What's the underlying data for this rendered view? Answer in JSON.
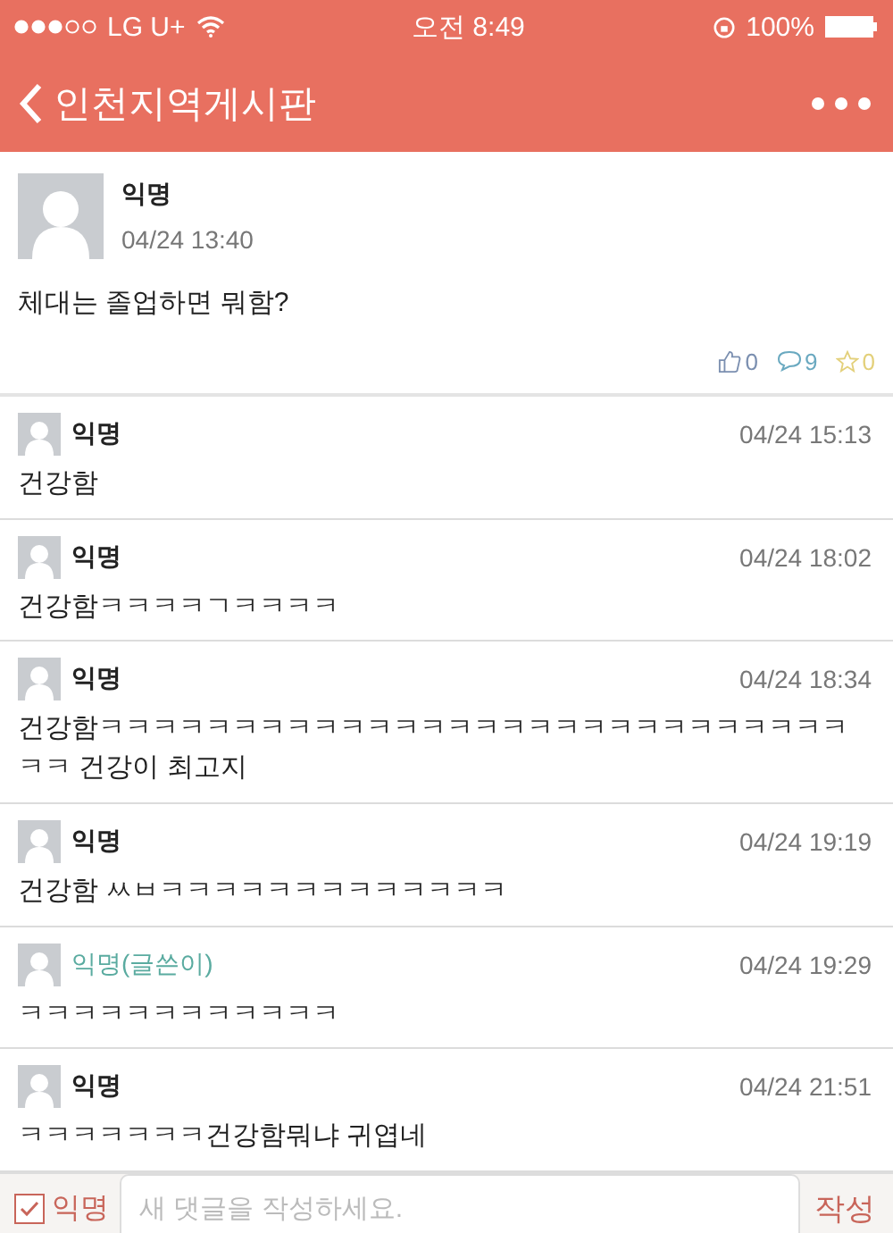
{
  "status_bar": {
    "carrier": "LG U+",
    "time": "오전 8:49",
    "battery": "100%"
  },
  "nav": {
    "title": "인천지역게시판"
  },
  "post": {
    "author": "익명",
    "date": "04/24 13:40",
    "body": "체대는 졸업하면 뭐함?",
    "likes": "0",
    "comments": "9",
    "favorites": "0"
  },
  "comments": [
    {
      "author": "익명",
      "is_op": false,
      "date": "04/24 15:13",
      "body": "건강함"
    },
    {
      "author": "익명",
      "is_op": false,
      "date": "04/24 18:02",
      "body": "건강함ㅋㅋㅋㅋㄱㅋㅋㅋㅋ"
    },
    {
      "author": "익명",
      "is_op": false,
      "date": "04/24 18:34",
      "body": "건강함ㅋㅋㅋㅋㅋㅋㅋㅋㅋㅋㅋㅋㅋㅋㅋㅋㅋㅋㅋㅋㅋㅋㅋㅋㅋㅋㅋㅋㅋㅋ 건강이 최고지"
    },
    {
      "author": "익명",
      "is_op": false,
      "date": "04/24 19:19",
      "body": "건강함 ㅆㅂㅋㅋㅋㅋㅋㅋㅋㅋㅋㅋㅋㅋㅋ"
    },
    {
      "author": "익명(글쓴이)",
      "is_op": true,
      "date": "04/24 19:29",
      "body": "ㅋㅋㅋㅋㅋㅋㅋㅋㅋㅋㅋㅋ"
    },
    {
      "author": "익명",
      "is_op": false,
      "date": "04/24 21:51",
      "body": "ㅋㅋㅋㅋㅋㅋㅋ건강함뭐냐 귀엽네"
    }
  ],
  "composer": {
    "anonymous_label": "익명",
    "anonymous_checked": true,
    "placeholder": "새 댓글을 작성하세요.",
    "submit": "작성"
  }
}
